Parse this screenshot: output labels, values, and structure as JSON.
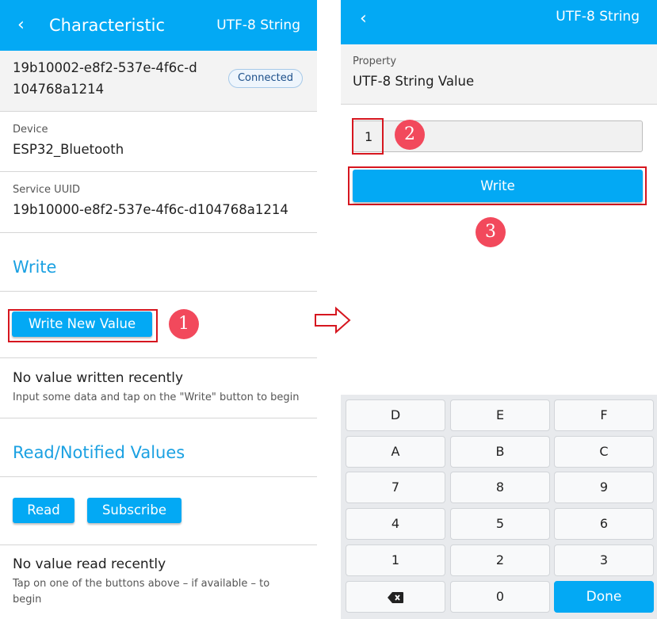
{
  "left": {
    "header": {
      "back_icon": "‹",
      "title": "Characteristic",
      "subtitle": "UTF-8 String"
    },
    "characteristic_uuid": "19b10002-e8f2-537e-4f6c-d104768a1214",
    "status_badge": "Connected",
    "device": {
      "label": "Device",
      "value": "ESP32_Bluetooth"
    },
    "service": {
      "label": "Service UUID",
      "value": "19b10000-e8f2-537e-4f6c-d104768a1214"
    },
    "write_section": {
      "title": "Write",
      "button": "Write New Value",
      "step": "1",
      "empty_title": "No value written recently",
      "empty_hint": "Input some data and tap on the \"Write\" button to begin"
    },
    "read_section": {
      "title": "Read/Notified Values",
      "read_button": "Read",
      "subscribe_button": "Subscribe",
      "empty_title": "No value read recently",
      "empty_hint": "Tap on one of the buttons above – if available – to begin"
    }
  },
  "right": {
    "header": {
      "back_icon": "‹",
      "subtitle": "UTF-8 String"
    },
    "property": {
      "label": "Property",
      "value": "UTF-8 String Value"
    },
    "input_value": "1",
    "step_input": "2",
    "write_button": "Write",
    "step_write": "3"
  },
  "keyboard": {
    "rows": [
      [
        "D",
        "E",
        "F"
      ],
      [
        "A",
        "B",
        "C"
      ],
      [
        "7",
        "8",
        "9"
      ],
      [
        "4",
        "5",
        "6"
      ],
      [
        "1",
        "2",
        "3"
      ],
      [
        "⌫",
        "0",
        "Done"
      ]
    ]
  },
  "colors": {
    "accent": "#03a9f4",
    "highlight": "#d6161f",
    "step_badge": "#f2495c"
  }
}
